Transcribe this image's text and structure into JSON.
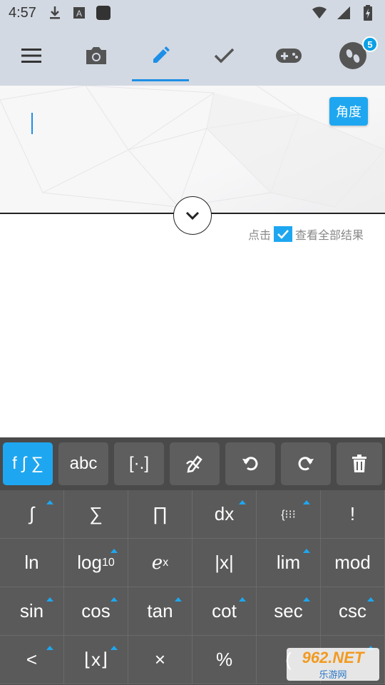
{
  "status_bar": {
    "time": "4:57"
  },
  "toolbar": {
    "badge_count": "5",
    "tabs": [
      "menu",
      "camera",
      "edit",
      "check",
      "games",
      "footprints"
    ]
  },
  "editor": {
    "angle_button": "角度",
    "show_all_prefix": "点击",
    "show_all_suffix": "查看全部结果",
    "show_all_checked": true
  },
  "keyboard": {
    "tabs": [
      "f ∫ ∑",
      "abc",
      "[·.]"
    ],
    "rows": [
      [
        "∫",
        "∑",
        "∏",
        "dx",
        "{⁝⁝⁝",
        "!"
      ],
      [
        "ln",
        "log",
        "e",
        "|x|",
        "lim",
        "mod"
      ],
      [
        "sin",
        "cos",
        "tan",
        "cot",
        "sec",
        "csc"
      ],
      [
        "<",
        "⌊x⌋",
        "×",
        "%",
        "(",
        ""
      ]
    ],
    "log_sub": "10",
    "exp_sup": "x"
  },
  "watermark": {
    "line1": "962.NET",
    "line2": "乐游网"
  },
  "colors": {
    "accent": "#1ea7f0",
    "toolbar_bg": "#d3d9e2",
    "key_bg": "#5a5a5a"
  }
}
